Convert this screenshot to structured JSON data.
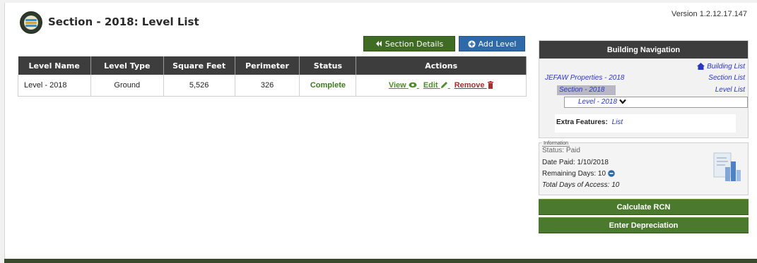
{
  "header": {
    "title": "Section - 2018: Level List",
    "version": "Version 1.2.12.17.147"
  },
  "toolbar": {
    "section_details_label": "Section Details",
    "add_level_label": "Add Level"
  },
  "table": {
    "columns": [
      "Level Name",
      "Level Type",
      "Square Feet",
      "Perimeter",
      "Status",
      "Actions"
    ],
    "rows": [
      {
        "level_name": "Level - 2018",
        "level_type": "Ground",
        "square_feet": "5,526",
        "perimeter": "326",
        "status": "Complete",
        "actions": {
          "view": "View",
          "edit": "Edit",
          "remove": "Remove"
        }
      }
    ]
  },
  "building_nav": {
    "title": "Building Navigation",
    "building_list": "Building List",
    "property": "JEFAW Properties - 2018",
    "section_list": "Section List",
    "section": "Section - 2018",
    "level_list": "Level List",
    "level": "Level - 2018",
    "extra_features_label": "Extra Features:",
    "extra_features_link": "List"
  },
  "information": {
    "legend": "Information",
    "status": "Status: Paid",
    "date_paid": "Date Paid: 1/10/2018",
    "remaining_days": "Remaining Days: 10",
    "total_days": "Total Days of Access: 10"
  },
  "actions": {
    "calculate_rcn": "Calculate RCN",
    "enter_depreciation": "Enter Depreciation"
  },
  "colors": {
    "dark_header": "#3d3d3d",
    "green_button": "#4b7a2e",
    "blue_button": "#2f6aa8",
    "link_blue": "#2a36c8",
    "status_green": "#3c7a1c",
    "remove_red": "#a53030"
  }
}
